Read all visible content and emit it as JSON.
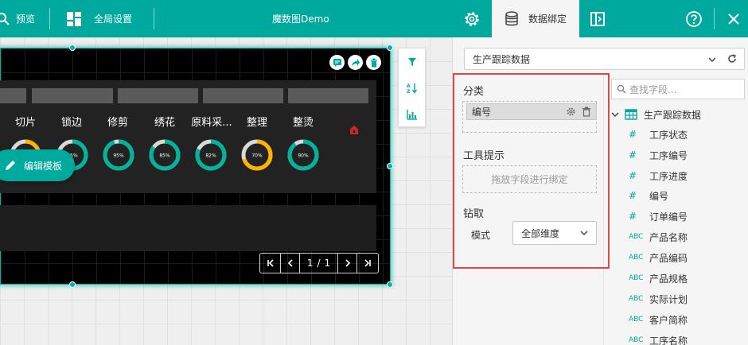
{
  "toolbar": {
    "preview_label": "预览",
    "global_settings_label": "全局设置",
    "title": "魔数图Demo",
    "data_binding_tab": "数据绑定"
  },
  "widget": {
    "columns": [
      "切片",
      "锁边",
      "修剪",
      "绣花",
      "原料采...",
      "整理",
      "整烫"
    ],
    "gauges": [
      {
        "label": "75%",
        "value": 0.75,
        "color": "#ffb300"
      },
      {
        "label": "75%",
        "value": 0.75,
        "color": "#00b39b"
      },
      {
        "label": "95%",
        "value": 0.95,
        "color": "#00b39b"
      },
      {
        "label": "85%",
        "value": 0.85,
        "color": "#00b39b"
      },
      {
        "label": "82%",
        "value": 0.82,
        "color": "#00b39b"
      },
      {
        "label": "70%",
        "value": 0.7,
        "color": "#ffb300"
      },
      {
        "label": "90%",
        "value": 0.9,
        "color": "#00b39b"
      }
    ],
    "edit_template_label": "编辑模板",
    "pager": {
      "current": "1",
      "separator": "/",
      "total": "1"
    }
  },
  "binding": {
    "dataset": "生产跟踪数据",
    "category_title": "分类",
    "category_field": "编号",
    "tooltip_title": "工具提示",
    "drop_hint": "拖放字段进行绑定",
    "drill_title": "钻取",
    "mode_label": "模式",
    "mode_value": "全部维度"
  },
  "fields": {
    "search_placeholder": "查找字段...",
    "root": "生产跟踪数据",
    "items": [
      {
        "type": "#",
        "name": "工序状态"
      },
      {
        "type": "#",
        "name": "工序编号"
      },
      {
        "type": "#",
        "name": "工序进度"
      },
      {
        "type": "#",
        "name": "编号"
      },
      {
        "type": "#",
        "name": "订单编号"
      },
      {
        "type": "ABC",
        "name": "产品名称"
      },
      {
        "type": "ABC",
        "name": "产品编码"
      },
      {
        "type": "ABC",
        "name": "产品规格"
      },
      {
        "type": "ABC",
        "name": "实际计划"
      },
      {
        "type": "ABC",
        "name": "客户简称"
      },
      {
        "type": "ABC",
        "name": "工序名称"
      }
    ]
  },
  "colors": {
    "accent": "#00a99d",
    "highlight_box": "#e0464a",
    "gauge_ok": "#00b39b",
    "gauge_warn": "#ffb300"
  }
}
